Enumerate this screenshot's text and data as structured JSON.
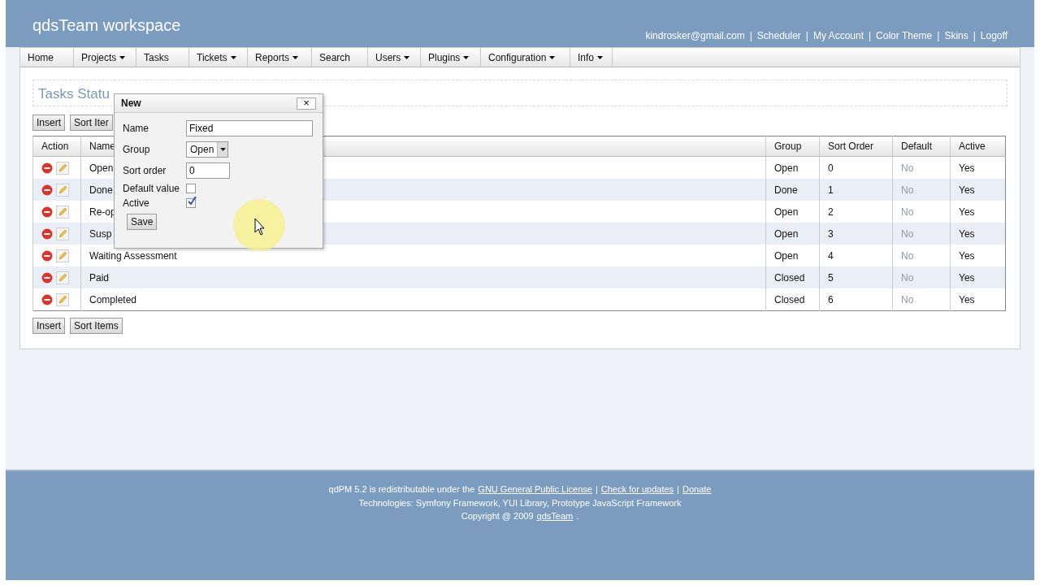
{
  "header": {
    "title": "qdsTeam workspace",
    "links": [
      "kindrosker@gmail.com",
      "Scheduler",
      "My Account",
      "Color Theme",
      "Skins",
      "Logoff"
    ],
    "separator": "|"
  },
  "menu": [
    {
      "label": "Home",
      "dropdown": false
    },
    {
      "label": "Projects",
      "dropdown": true
    },
    {
      "label": "Tasks",
      "dropdown": false
    },
    {
      "label": "Tickets",
      "dropdown": true
    },
    {
      "label": "Reports",
      "dropdown": true
    },
    {
      "label": "Search",
      "dropdown": false
    },
    {
      "label": "Users",
      "dropdown": true
    },
    {
      "label": "Plugins",
      "dropdown": true
    },
    {
      "label": "Configuration",
      "dropdown": true
    },
    {
      "label": "Info",
      "dropdown": true
    }
  ],
  "page_title": "Tasks Statu",
  "top_buttons": [
    "Insert",
    "Sort Iter"
  ],
  "table": {
    "columns": [
      "Action",
      "Name",
      "Group",
      "Sort Order",
      "Default",
      "Active"
    ],
    "rows": [
      {
        "name": "Open",
        "group": "Open",
        "sort_order": "0",
        "default": "No",
        "active": "Yes"
      },
      {
        "name": "Done",
        "group": "Done",
        "sort_order": "1",
        "default": "No",
        "active": "Yes"
      },
      {
        "name": "Re-op",
        "group": "Open",
        "sort_order": "2",
        "default": "No",
        "active": "Yes"
      },
      {
        "name": "Susp",
        "group": "Open",
        "sort_order": "3",
        "default": "No",
        "active": "Yes"
      },
      {
        "name": "Waiting Assessment",
        "group": "Open",
        "sort_order": "4",
        "default": "No",
        "active": "Yes"
      },
      {
        "name": "Paid",
        "group": "Closed",
        "sort_order": "5",
        "default": "No",
        "active": "Yes"
      },
      {
        "name": "Completed",
        "group": "Closed",
        "sort_order": "6",
        "default": "No",
        "active": "Yes"
      }
    ]
  },
  "bottom_buttons": [
    "Insert",
    "Sort Items"
  ],
  "dialog": {
    "title": "New",
    "close": "×",
    "fields": [
      {
        "kind": "text",
        "label": "Name",
        "value": "Fixed"
      },
      {
        "kind": "select",
        "label": "Group",
        "value": "Open"
      },
      {
        "kind": "number",
        "label": "Sort order",
        "value": "0"
      },
      {
        "kind": "checkbox",
        "label": "Default value",
        "checked": false
      },
      {
        "kind": "checkbox",
        "label": "Active",
        "checked": true
      }
    ],
    "save": "Save"
  },
  "footer": {
    "line1_prefix": "qdPM 5.2  is redistributable under the",
    "line1_links": [
      "GNU General Public License",
      "Check for updates",
      "Donate"
    ],
    "separator": "|",
    "line2": "Technologies: Symfony Framework, YUI Library, Prototype JavaScript Framework",
    "line3_prefix": "Copyright @ 2009",
    "line3_link": "qdsTeam",
    "line3_suffix": "."
  }
}
